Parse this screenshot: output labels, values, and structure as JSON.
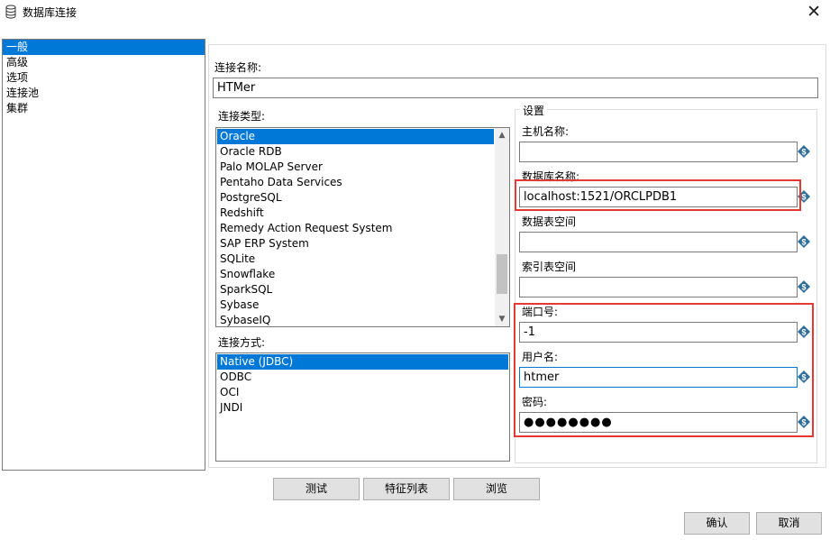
{
  "window": {
    "title": "数据库连接",
    "icon": "database-icon",
    "close_glyph": "✕"
  },
  "nav": {
    "items": [
      {
        "label": "一般",
        "selected": true
      },
      {
        "label": "高级",
        "selected": false
      },
      {
        "label": "选项",
        "selected": false
      },
      {
        "label": "连接池",
        "selected": false
      },
      {
        "label": "集群",
        "selected": false
      }
    ]
  },
  "general": {
    "connection_name_label": "连接名称:",
    "connection_name_value": "HTMer",
    "connection_type_label": "连接类型:",
    "connection_types": [
      "Oracle",
      "Oracle RDB",
      "Palo MOLAP Server",
      "Pentaho Data Services",
      "PostgreSQL",
      "Redshift",
      "Remedy Action Request System",
      "SAP ERP System",
      "SQLite",
      "Snowflake",
      "SparkSQL",
      "Sybase",
      "SybaseIQ"
    ],
    "connection_type_selected": "Oracle",
    "access_label": "连接方式:",
    "access_methods": [
      "Native (JDBC)",
      "ODBC",
      "OCI",
      "JNDI"
    ],
    "access_selected": "Native (JDBC)"
  },
  "settings": {
    "group_title": "设置",
    "host_label": "主机名称:",
    "host_value": "",
    "db_label": "数据库名称:",
    "db_value": "localhost:1521/ORCLPDB1",
    "data_tablespace_label": "数据表空间",
    "data_tablespace_value": "",
    "index_tablespace_label": "索引表空间",
    "index_tablespace_value": "",
    "port_label": "端口号:",
    "port_value": "-1",
    "user_label": "用户名:",
    "user_value": "htmer",
    "password_label": "密码:",
    "password_value": "●●●●●●●●",
    "variable_icon": "variable-diamond-icon"
  },
  "buttons": {
    "test": "测试",
    "feature_list": "特征列表",
    "explore": "浏览",
    "ok": "确认",
    "cancel": "取消"
  },
  "colors": {
    "selection": "#0078d7",
    "highlight_box": "#e53935",
    "variable_icon": "#2f6f9a"
  }
}
